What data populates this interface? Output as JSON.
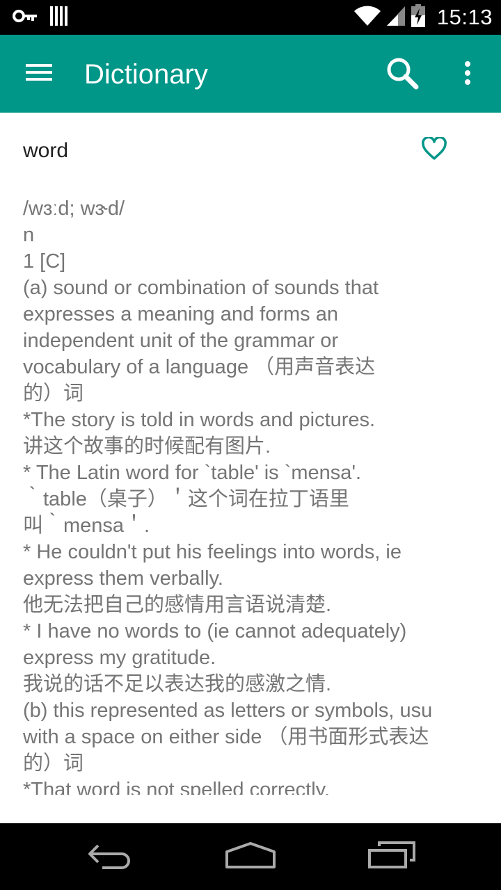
{
  "status_bar": {
    "time": "15:13",
    "icons": [
      "key-icon",
      "barcode-icon",
      "wifi-icon",
      "signal-icon",
      "battery-icon"
    ]
  },
  "app_bar": {
    "title": "Dictionary",
    "background_color": "#009688",
    "icons": [
      "menu-icon",
      "search-icon",
      "more-vert-icon"
    ]
  },
  "entry": {
    "word": "word",
    "favorite_icon": "heart-outline-icon",
    "accent_color": "#009688",
    "lines": [
      "/wɜːd; wɝd/",
      "n",
      "1 [C]",
      "(a) sound or combination of sounds that",
      "expresses a meaning and forms an",
      "independent unit of the grammar or",
      "vocabulary of a language （用声音表达",
      "的）词",
      "*The story is told in words and pictures.",
      "讲这个故事的时候配有图片.",
      "* The Latin word for `table' is `mensa'.",
      "｀table（桌子）＇这个词在拉丁语里",
      "叫｀mensa＇.",
      "* He couldn't put his feelings into words, ie",
      "express them verbally.",
      "他无法把自己的感情用言语说清楚.",
      "* I have no words to (ie cannot adequately)",
      "express my gratitude.",
      "我说的话不足以表达我的感激之情.",
      "(b) this represented as letters or symbols, usu",
      "with a space on either side （用书面形式表达",
      "的）词",
      "*That word is not spelled correctly."
    ]
  },
  "nav_bar": {
    "icons": [
      "back-icon",
      "home-icon",
      "recents-icon"
    ]
  }
}
